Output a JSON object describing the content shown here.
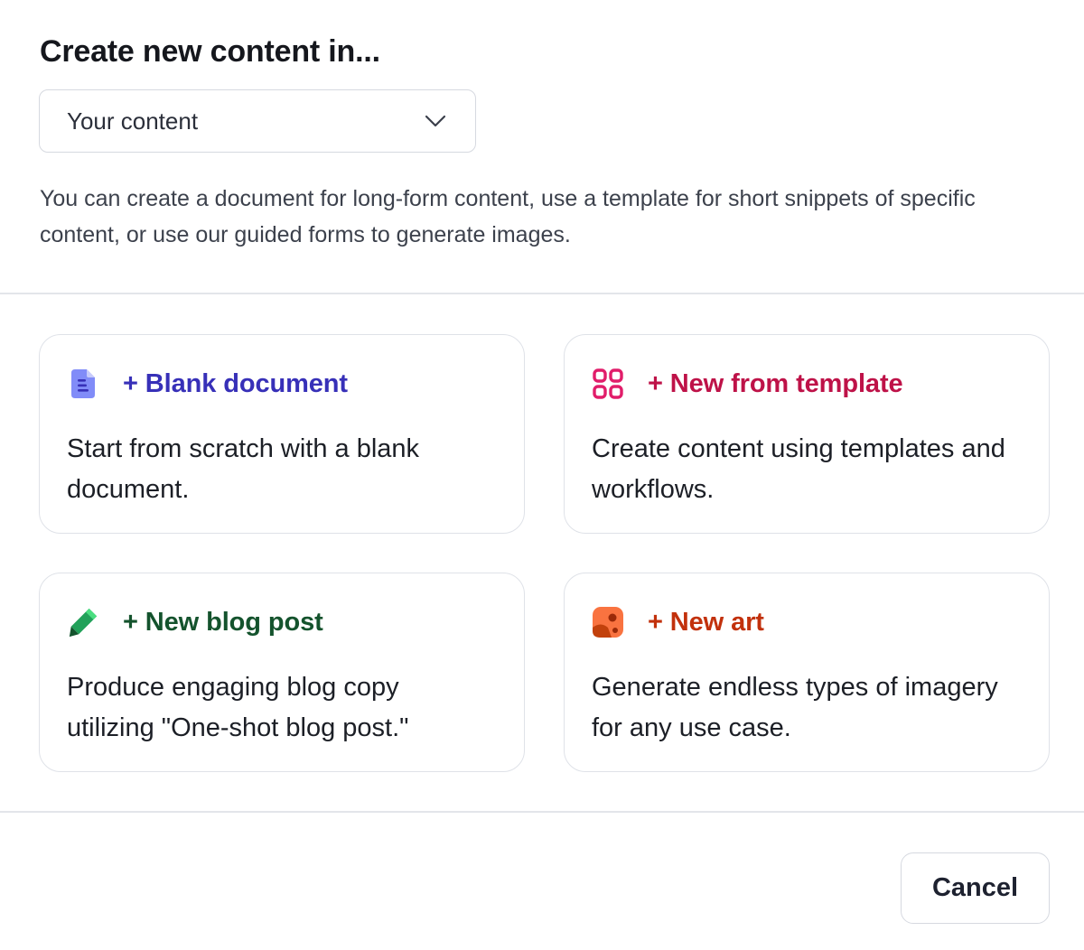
{
  "dialog": {
    "title": "Create new content in..."
  },
  "location_select": {
    "value": "Your content"
  },
  "description": "You can create a document for long-form content, use a template for short snippets of specific content, or use our guided forms to generate images.",
  "cards": [
    {
      "title": "+ Blank document",
      "body": "Start from scratch with a blank document.",
      "icon": "document-icon",
      "color": "#3730b8",
      "icon_color": "#818cf8"
    },
    {
      "title": "+ New from template",
      "body": "Create content using templates and workflows.",
      "icon": "template-grid-icon",
      "color": "#be1248",
      "icon_color": "#e11d6a"
    },
    {
      "title": "+ New blog post",
      "body": "Produce engaging blog copy utilizing \"One-shot blog post.\"",
      "icon": "pencil-icon",
      "color": "#14532d",
      "icon_color": "#22a15a"
    },
    {
      "title": "+ New art",
      "body": "Generate endless types of imagery for any use case.",
      "icon": "image-art-icon",
      "color": "#c2310c",
      "icon_color": "#f97340"
    }
  ],
  "footer": {
    "cancel_label": "Cancel"
  }
}
